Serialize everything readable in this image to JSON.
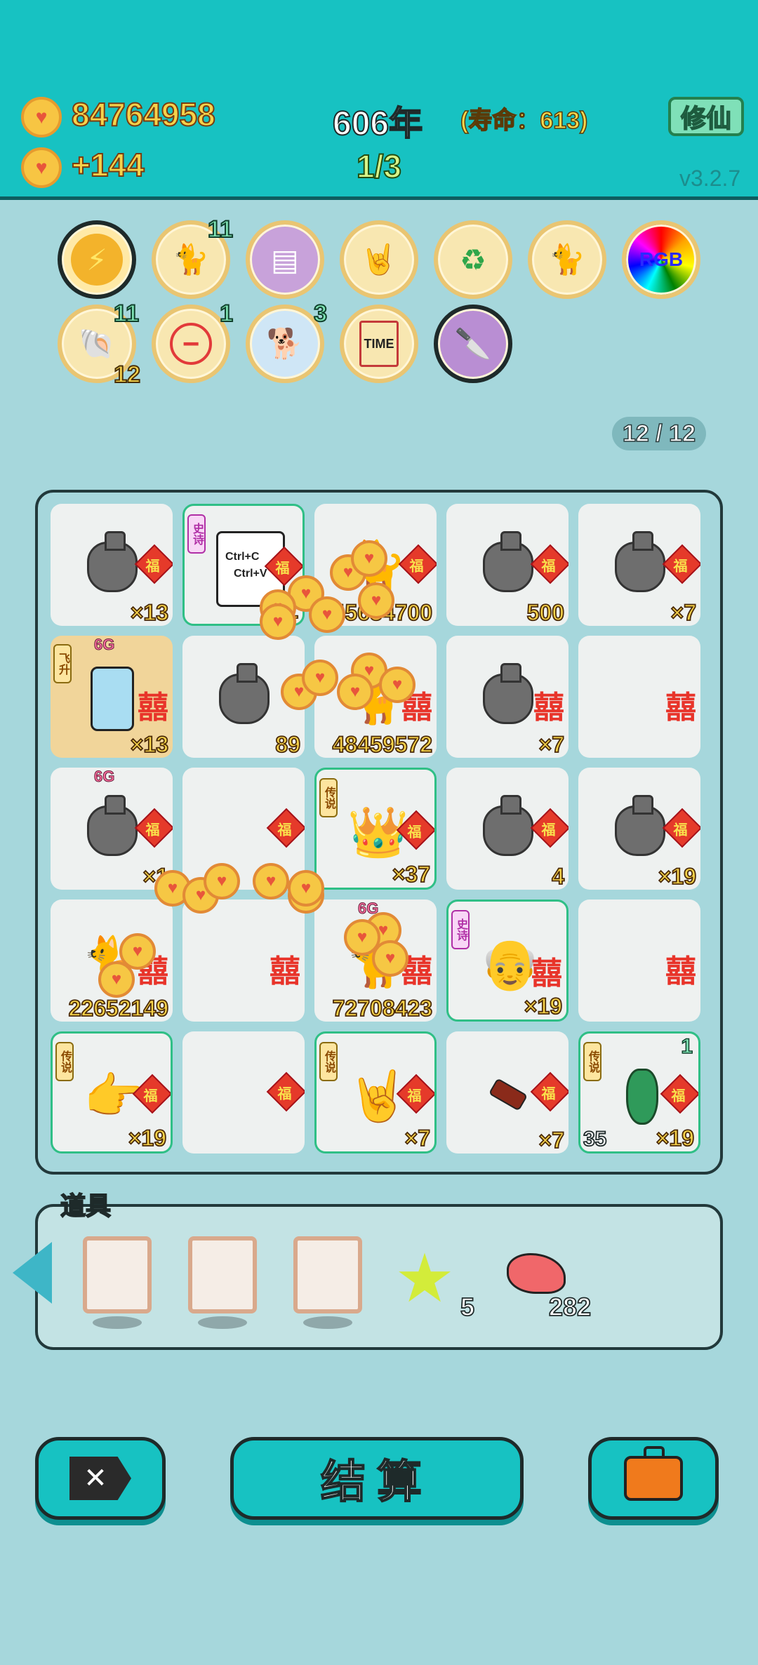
{
  "header": {
    "coins": "84764958",
    "income": "+144",
    "year": "606年",
    "lifespan": "(寿命：613)",
    "progress": "1/3",
    "xiuxian_label": "修仙",
    "version": "v3.2.7"
  },
  "relics": {
    "row1": [
      {
        "icon": "lightning-icon",
        "count": ""
      },
      {
        "icon": "cat-eating-icon",
        "count": "11"
      },
      {
        "icon": "skirt-icon",
        "count": ""
      },
      {
        "icon": "rock-hand-icon",
        "count": ""
      },
      {
        "icon": "recycle-icon",
        "count": ""
      },
      {
        "icon": "twin-cats-icon",
        "count": ""
      },
      {
        "icon": "rgb-icon",
        "label": "RGB",
        "count": ""
      }
    ],
    "row2": [
      {
        "icon": "shell-icon",
        "count": "11",
        "sub": "12"
      },
      {
        "icon": "minus-icon",
        "count": "1"
      },
      {
        "icon": "husky-icon",
        "count": "3"
      },
      {
        "icon": "time-magazine-icon",
        "label": "TIME",
        "count": ""
      },
      {
        "icon": "cleaver-icon",
        "count": ""
      }
    ]
  },
  "slot_counter": "12 / 12",
  "board": {
    "cells": [
      {
        "art": "bag",
        "badge": "福",
        "value": "×13"
      },
      {
        "art": "ctrl",
        "tag": "史诗",
        "badge": "福",
        "value": "51",
        "ctrl_c": "Ctrl+C",
        "ctrl_v": "Ctrl+V"
      },
      {
        "art": "cat",
        "badge": "福",
        "value": "45684700"
      },
      {
        "art": "bag",
        "badge": "福",
        "value": "500"
      },
      {
        "art": "bag",
        "badge": "福",
        "value": "×7"
      },
      {
        "art": "fridge",
        "tag": "飞升",
        "six": "6G",
        "badge": "囍",
        "value": "×13"
      },
      {
        "art": "bag",
        "badge": "",
        "value": "89"
      },
      {
        "art": "cat",
        "badge": "囍",
        "value": "48459572"
      },
      {
        "art": "bag",
        "badge": "囍",
        "value": "×7"
      },
      {
        "art": "empty",
        "badge": "囍",
        "value": ""
      },
      {
        "art": "bag",
        "six": "6G",
        "badge": "福",
        "value": "×1"
      },
      {
        "art": "empty",
        "badge": "福",
        "value": ""
      },
      {
        "art": "king",
        "tag": "传说",
        "badge": "福",
        "value": "×37"
      },
      {
        "art": "bag",
        "badge": "福",
        "value": "4"
      },
      {
        "art": "bag",
        "badge": "福",
        "value": "×19"
      },
      {
        "art": "cat",
        "badge": "囍",
        "value": "22652149"
      },
      {
        "art": "empty",
        "badge": "囍",
        "value": ""
      },
      {
        "art": "cat",
        "six": "6G",
        "badge": "囍",
        "value": "72708423"
      },
      {
        "art": "oldking",
        "tag": "史诗",
        "badge": "囍",
        "value": "×19"
      },
      {
        "art": "empty",
        "badge": "囍",
        "value": ""
      },
      {
        "art": "pointhand",
        "tag": "传说",
        "badge": "福",
        "value": "×19"
      },
      {
        "art": "empty",
        "badge": "福",
        "value": ""
      },
      {
        "art": "rockhand",
        "tag": "传说",
        "badge": "福",
        "value": "×7"
      },
      {
        "art": "battery",
        "badge": "福",
        "value": "×7"
      },
      {
        "art": "vase",
        "tag": "传说",
        "badge": "福",
        "value": "×19",
        "corner": "1",
        "lnum": "35"
      }
    ]
  },
  "tools": {
    "label": "道具",
    "star_count": "5",
    "liver_count": "282"
  },
  "buttons": {
    "settle": "结算"
  },
  "colors": {
    "header_bg": "#17c2c2",
    "page_bg": "#a6d7dc",
    "gold": "#f6d249"
  }
}
